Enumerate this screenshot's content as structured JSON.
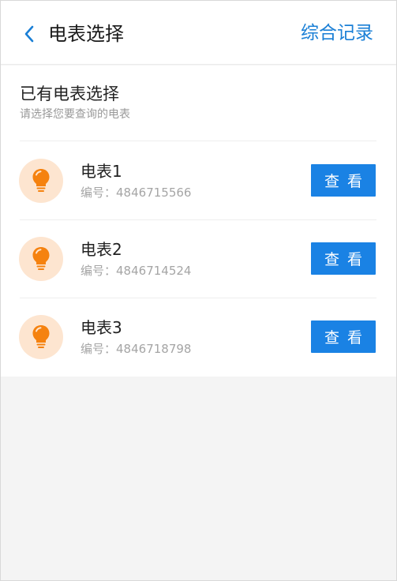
{
  "header": {
    "title": "电表选择",
    "records_link": "综合记录"
  },
  "section": {
    "title": "已有电表选择",
    "subtitle": "请选择您要查询的电表"
  },
  "meters": [
    {
      "name": "电表1",
      "code_label": "编号：",
      "code": "4846715566",
      "button": "查看"
    },
    {
      "name": "电表2",
      "code_label": "编号：",
      "code": "4846714524",
      "button": "查看"
    },
    {
      "name": "电表3",
      "code_label": "编号：",
      "code": "4846718798",
      "button": "查看"
    }
  ],
  "icons": {
    "back": "chevron-left-icon",
    "meter": "lightbulb-icon"
  },
  "colors": {
    "accent": "#1a82e4",
    "link": "#1a7fd6",
    "bulb": "#f5820f",
    "bulb_bg": "#fde5d0"
  }
}
